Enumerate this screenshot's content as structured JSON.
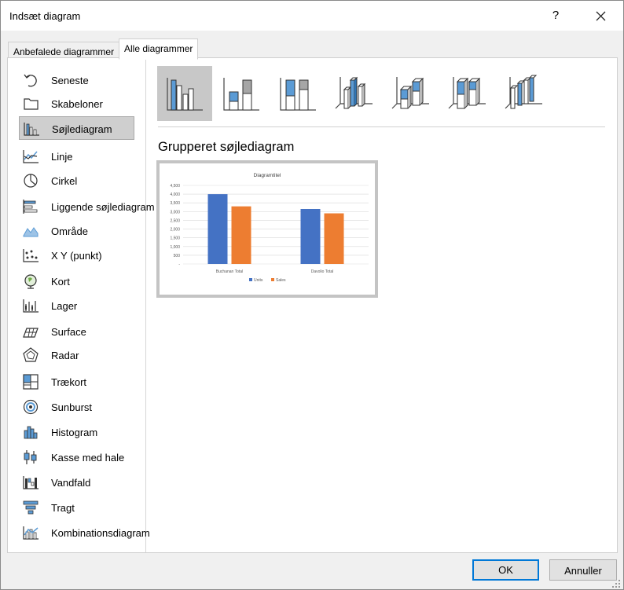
{
  "dialog": {
    "title": "Indsæt diagram",
    "help": "?"
  },
  "tabs": [
    {
      "label": "Anbefalede diagrammer"
    },
    {
      "label": "Alle diagrammer"
    }
  ],
  "sidebar": {
    "items": [
      {
        "label": "Seneste",
        "icon": "recent-icon"
      },
      {
        "label": "Skabeloner",
        "icon": "folder-icon"
      },
      {
        "label": "Søjlediagram",
        "icon": "column-chart-icon",
        "selected": true
      },
      {
        "label": "Linje",
        "icon": "line-chart-icon"
      },
      {
        "label": "Cirkel",
        "icon": "pie-chart-icon"
      },
      {
        "label": "Liggende søjlediagram",
        "icon": "bar-chart-icon"
      },
      {
        "label": "Område",
        "icon": "area-chart-icon"
      },
      {
        "label": "X Y (punkt)",
        "icon": "scatter-chart-icon"
      },
      {
        "label": "Kort",
        "icon": "map-chart-icon"
      },
      {
        "label": "Lager",
        "icon": "stock-chart-icon"
      },
      {
        "label": "Surface",
        "icon": "surface-chart-icon"
      },
      {
        "label": "Radar",
        "icon": "radar-chart-icon"
      },
      {
        "label": "Trækort",
        "icon": "treemap-chart-icon"
      },
      {
        "label": "Sunburst",
        "icon": "sunburst-chart-icon"
      },
      {
        "label": "Histogram",
        "icon": "histogram-chart-icon"
      },
      {
        "label": "Kasse med hale",
        "icon": "box-whisker-chart-icon"
      },
      {
        "label": "Vandfald",
        "icon": "waterfall-chart-icon"
      },
      {
        "label": "Tragt",
        "icon": "funnel-chart-icon"
      },
      {
        "label": "Kombinationsdiagram",
        "icon": "combo-chart-icon"
      }
    ]
  },
  "subtype_title": "Grupperet søjlediagram",
  "preview": {
    "chart_data": {
      "type": "bar",
      "title": "Diagramtitel",
      "categories": [
        "Buchanan Total",
        "Davolio Total"
      ],
      "series": [
        {
          "name": "Units",
          "values": [
            4000,
            3150
          ],
          "color": "#4472c4"
        },
        {
          "name": "Sales",
          "values": [
            3300,
            2900
          ],
          "color": "#ed7d31"
        }
      ],
      "ylim": [
        0,
        4500
      ],
      "yticks": [
        "4,500",
        "4,000",
        "3,500",
        "3,000",
        "2,500",
        "2,000",
        "1,500",
        "1,000",
        "500",
        "-"
      ],
      "grid": true,
      "legend": "bottom"
    }
  },
  "buttons": {
    "ok": "OK",
    "cancel": "Annuller"
  }
}
